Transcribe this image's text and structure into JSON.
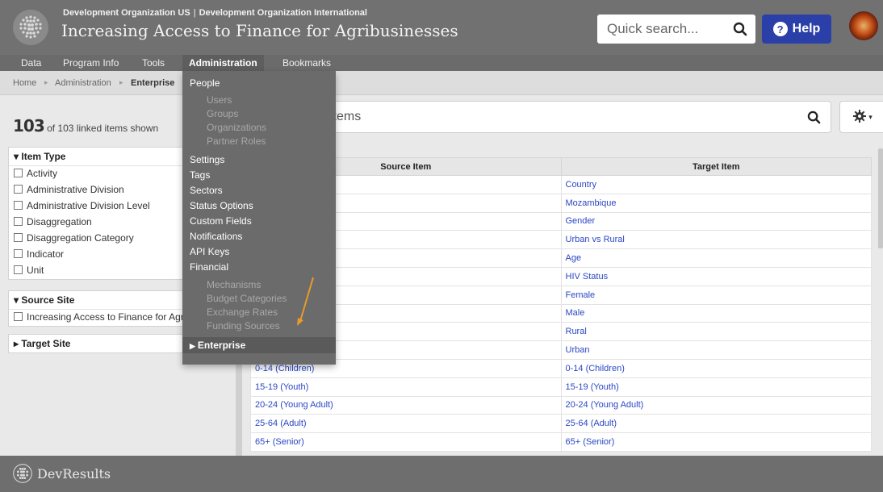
{
  "header": {
    "org_primary": "Development Organization US",
    "org_separator": "|",
    "org_secondary": "Development Organization International",
    "site_title": "Increasing Access to Finance for Agribusinesses",
    "search_placeholder": "Quick search...",
    "help_label": "Help"
  },
  "nav": {
    "items": [
      {
        "label": "Data"
      },
      {
        "label": "Program Info"
      },
      {
        "label": "Tools"
      },
      {
        "label": "Administration"
      },
      {
        "label": "Bookmarks"
      }
    ]
  },
  "breadcrumb": {
    "items": [
      "Home",
      "Administration",
      "Enterprise"
    ]
  },
  "left": {
    "count_number": "103",
    "count_text": "of 103 linked items shown",
    "facets": [
      {
        "title": "Item Type",
        "expanded": true,
        "options": [
          "Activity",
          "Administrative Division",
          "Administrative Division Level",
          "Disaggregation",
          "Disaggregation Category",
          "Indicator",
          "Unit"
        ]
      },
      {
        "title": "Source Site",
        "expanded": true,
        "options": [
          "Increasing Access to Finance for Agribusinesses"
        ]
      },
      {
        "title": "Target Site",
        "expanded": false,
        "options": []
      }
    ]
  },
  "content": {
    "filter_text": "items",
    "table": {
      "headers": [
        "Source Item",
        "Target Item"
      ],
      "rows": [
        [
          "",
          "Country"
        ],
        [
          "",
          "Mozambique"
        ],
        [
          "",
          "Gender"
        ],
        [
          "",
          "Urban vs Rural"
        ],
        [
          "",
          "Age"
        ],
        [
          "",
          "HIV Status"
        ],
        [
          "",
          "Female"
        ],
        [
          "",
          "Male"
        ],
        [
          "",
          "Rural"
        ],
        [
          "",
          "Urban"
        ],
        [
          "0-14 (Children)",
          "0-14 (Children)"
        ],
        [
          "15-19 (Youth)",
          "15-19 (Youth)"
        ],
        [
          "20-24 (Young Adult)",
          "20-24 (Young Adult)"
        ],
        [
          "25-64 (Adult)",
          "25-64 (Adult)"
        ],
        [
          "65+ (Senior)",
          "65+ (Senior)"
        ]
      ]
    }
  },
  "admin_menu": {
    "people": "People",
    "people_sub": [
      "Users",
      "Groups",
      "Organizations",
      "Partner Roles"
    ],
    "items": [
      "Settings",
      "Tags",
      "Sectors",
      "Status Options",
      "Custom Fields",
      "Notifications",
      "API Keys",
      "Financial"
    ],
    "financial_sub": [
      "Mechanisms",
      "Budget Categories",
      "Exchange Rates",
      "Funding Sources"
    ],
    "enterprise": "Enterprise"
  },
  "footer": {
    "brand": "DevResults"
  },
  "colors": {
    "header_bg": "#717171",
    "help_button": "#2b3fa8",
    "link": "#2b47c4",
    "annotation_arrow": "#e89a2c"
  }
}
